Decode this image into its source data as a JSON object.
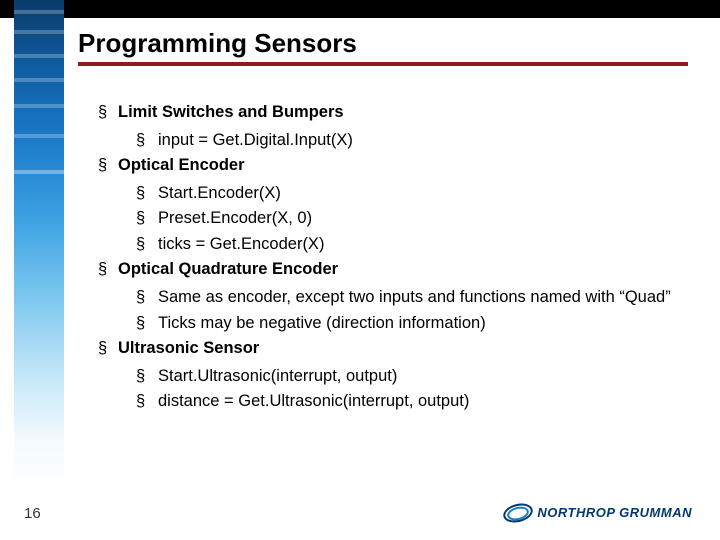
{
  "title": "Programming Sensors",
  "page_number": "16",
  "brand": {
    "name": "NORTHROP GRUMMAN"
  },
  "items": [
    {
      "label": "Limit Switches and Bumpers",
      "sub": [
        "input = Get.Digital.Input(X)"
      ]
    },
    {
      "label": "Optical Encoder",
      "sub": [
        "Start.Encoder(X)",
        "Preset.Encoder(X, 0)",
        "ticks = Get.Encoder(X)"
      ]
    },
    {
      "label": "Optical Quadrature Encoder",
      "sub": [
        "Same as encoder, except two inputs and functions named with “Quad”",
        "Ticks may be negative (direction information)"
      ]
    },
    {
      "label": "Ultrasonic Sensor",
      "sub": [
        "Start.Ultrasonic(interrupt, output)",
        "distance = Get.Ultrasonic(interrupt, output)"
      ]
    }
  ]
}
